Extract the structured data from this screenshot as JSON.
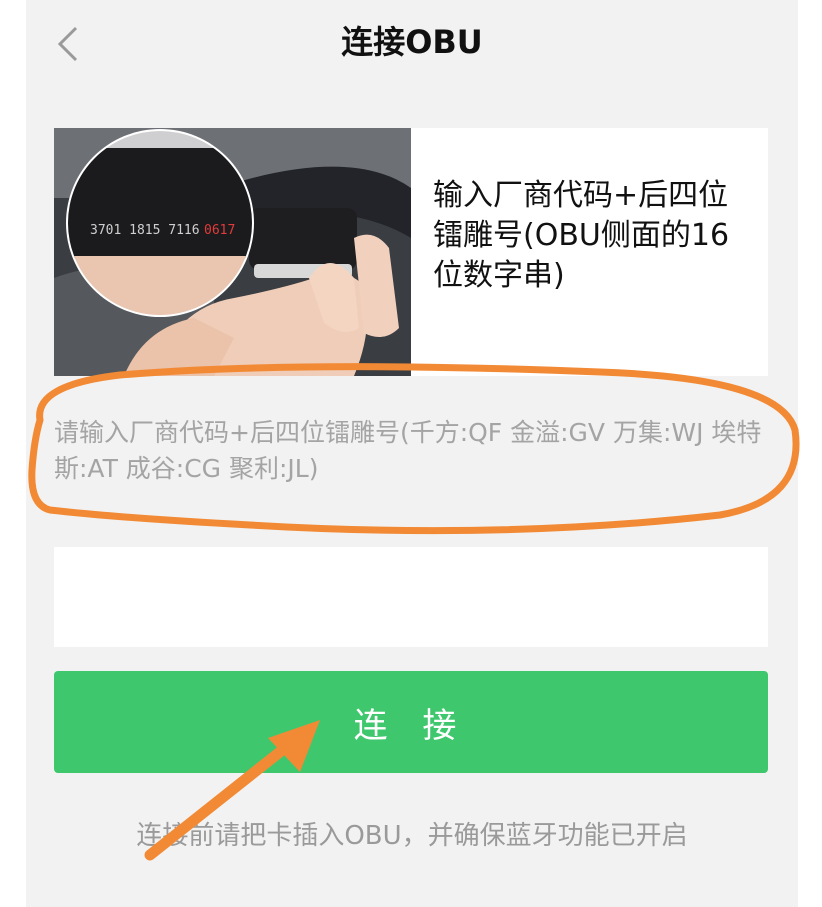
{
  "nav": {
    "title": "连接OBU",
    "back_icon": "chevron-left-icon"
  },
  "instruction_card": {
    "text": "输入厂商代码+后四位镭雕号(OBU侧面的16位数字串)",
    "photo_serial": "3701 1815 7116 0617"
  },
  "input": {
    "placeholder": "请输入厂商代码+后四位镭雕号(千方:QF 金溢:GV 万集:WJ 埃特斯:AT 成谷:CG 聚利:JL)",
    "value": ""
  },
  "connect_button": {
    "label": "连 接"
  },
  "footer_note": "连接前请把卡插入OBU，并确保蓝牙功能已开启",
  "colors": {
    "button_green": "#3ec76d",
    "annotation_orange": "#f28a35",
    "page_bg": "#f2f2f2"
  }
}
